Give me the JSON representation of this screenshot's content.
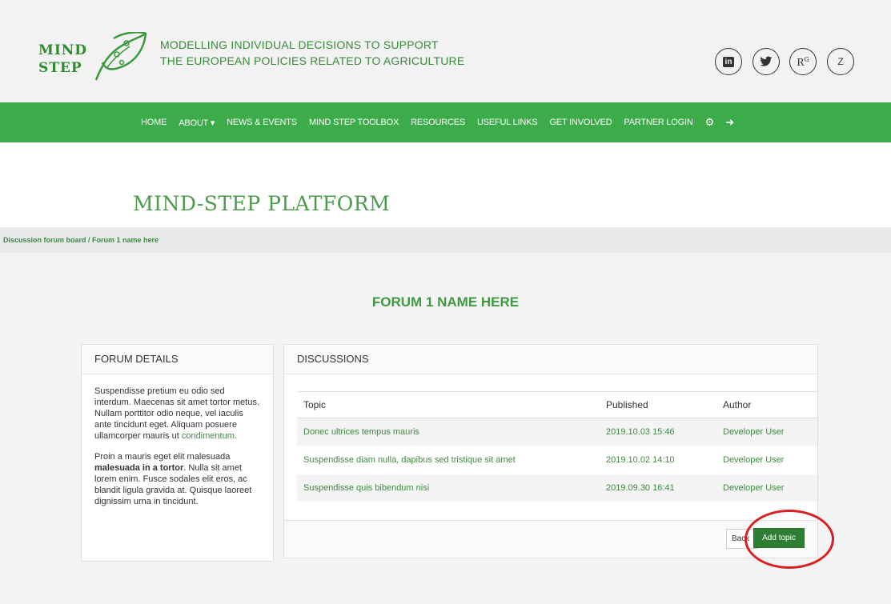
{
  "brand": {
    "logo_line1": "MIND",
    "logo_line2": "STEP",
    "tagline_line1": "MODELLING INDIVIDUAL DECISIONS TO SUPPORT",
    "tagline_line2": "THE EUROPEAN POLICIES RELATED TO AGRICULTURE"
  },
  "social": {
    "linkedin": "in",
    "twitter": "twitter-icon",
    "researchgate": "RG",
    "zenodo": "Z"
  },
  "nav": {
    "items": [
      "HOME",
      "ABOUT ▾",
      "NEWS & EVENTS",
      "MIND STEP TOOLBOX",
      "RESOURCES",
      "USEFUL LINKS",
      "GET INVOLVED",
      "PARTNER LOGIN"
    ],
    "icons": [
      "cogs-icon",
      "sign-out-icon"
    ]
  },
  "page": {
    "title": "MIND-STEP PLATFORM",
    "breadcrumb": "Discussion forum board / Forum 1 name here",
    "forum_title": "FORUM 1 NAME HERE"
  },
  "details": {
    "heading": "FORUM DETAILS",
    "para1_text": "Suspendisse pretium eu odio sed interdum. Maecenas sit amet tortor metus. Nullam porttitor odio neque, vel iaculis ante tincidunt eget. Aliquam posuere ullamcorper mauris ut",
    "para1_link": "condimentum.",
    "para2_a": "Proin a mauris eget elit malesuada",
    "para2_bold": "malesuada in a tortor",
    "para2_b": ". Nulla sit amet lorem enim. Fusce sodales elit eros, ac blandit ligula gravida at. Quisque laoreet dignissim urna in tincidunt."
  },
  "discussions": {
    "heading": "DISCUSSIONS",
    "columns": [
      "Topic",
      "Published",
      "Author"
    ],
    "rows": [
      {
        "topic": "Donec ultrices tempus mauris",
        "published": "2019.10.03 15:46",
        "author": "Developer User"
      },
      {
        "topic": "Suspendisse diam nulla, dapibus sed tristique sit amet",
        "published": "2019.10.02 14:10",
        "author": "Developer User"
      },
      {
        "topic": "Suspendisse quis bibendum nisi",
        "published": "2019.09.30 16:41",
        "author": "Developer User"
      }
    ],
    "back_label": "Back",
    "add_label": "Add topic"
  },
  "colors": {
    "nav_green": "#3cab4a",
    "brand_green": "#3e8a3e",
    "button_green": "#2e7d32",
    "highlight_red": "#d82020"
  }
}
